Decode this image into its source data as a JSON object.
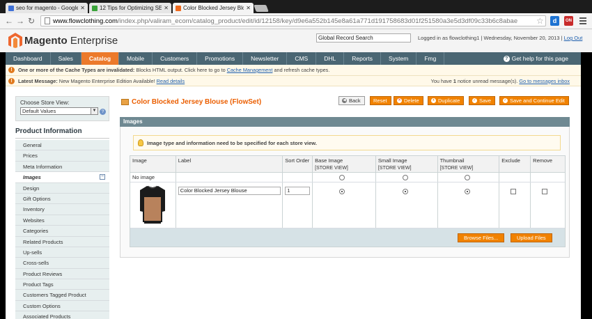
{
  "browser": {
    "tabs": [
      {
        "label": "seo for magento - Google",
        "icon_color": "#3f71d8"
      },
      {
        "label": "12 Tips for Optimizing SE",
        "icon_color": "#3aa33a"
      },
      {
        "label": "Color Blocked Jersey Blou",
        "icon_color": "#ee6a1e"
      }
    ],
    "address": {
      "host": "www.flowclothing.com",
      "path": "/index.php/valiram_ecom/catalog_product/edit/id/12158/key/d9e6a552b145e8a61a771d191758683d01f251580a3e5d3df09c33b6c8abae"
    },
    "extensions": [
      {
        "name": "d-extension-icon",
        "letter": "d",
        "color": "#1e73d2"
      },
      {
        "name": "red-extension-icon",
        "letter": "ON",
        "color": "#c82b2b"
      }
    ]
  },
  "header": {
    "brand_bold": "Magento",
    "brand_light": " Enterprise",
    "search_value": "Global Record Search",
    "logged_in": "Logged in as flowclothing1",
    "separator": "|",
    "date": "Wednesday, November 20, 2013",
    "logout": "Log Out"
  },
  "nav": {
    "items": [
      "Dashboard",
      "Sales",
      "Catalog",
      "Mobile",
      "Customers",
      "Promotions",
      "Newsletter",
      "CMS",
      "DHL",
      "Reports",
      "System",
      "Fmg"
    ],
    "active": "Catalog",
    "help": "Get help for this page"
  },
  "notices": {
    "cache": {
      "bold": "One or more of the Cache Types are invalidated:",
      "text": " Blocks HTML output. Click here to go to ",
      "link": "Cache Management",
      "tail": " and refresh cache types."
    },
    "latest": {
      "bold": "Latest Message:",
      "text": " New Magento Enterprise Edition Available! ",
      "link": "Read details",
      "right_pre": "You have ",
      "right_count": "1",
      "right_mid": " notice unread message(s). ",
      "right_link": "Go to messages inbox"
    }
  },
  "sidebar": {
    "store_label": "Choose Store View:",
    "store_value": "Default Values",
    "title": "Product Information",
    "items": [
      "General",
      "Prices",
      "Meta Information",
      "Images",
      "Design",
      "Gift Options",
      "Inventory",
      "Websites",
      "Categories",
      "Related Products",
      "Up-sells",
      "Cross-sells",
      "Product Reviews",
      "Product Tags",
      "Customers Tagged Product",
      "Custom Options",
      "Associated Products"
    ],
    "active": "Images"
  },
  "content": {
    "title": "Color Blocked Jersey Blouse (FlowSet)",
    "buttons": {
      "back": "Back",
      "reset": "Reset",
      "delete": "Delete",
      "duplicate": "Duplicate",
      "save": "Save",
      "save_continue": "Save and Continue Edit"
    },
    "section_title": "Images",
    "note": "Image type and information need to be specified for each store view.",
    "columns": [
      "Image",
      "Label",
      "Sort Order",
      "Base Image",
      "Small Image",
      "Thumbnail",
      "Exclude",
      "Remove"
    ],
    "store_view_tag": "[STORE VIEW]",
    "no_image_label": "No image",
    "row": {
      "label": "Color Blocked Jersey Blouse",
      "sort_order": "1"
    },
    "browse": "Browse Files...",
    "upload": "Upload Files"
  }
}
